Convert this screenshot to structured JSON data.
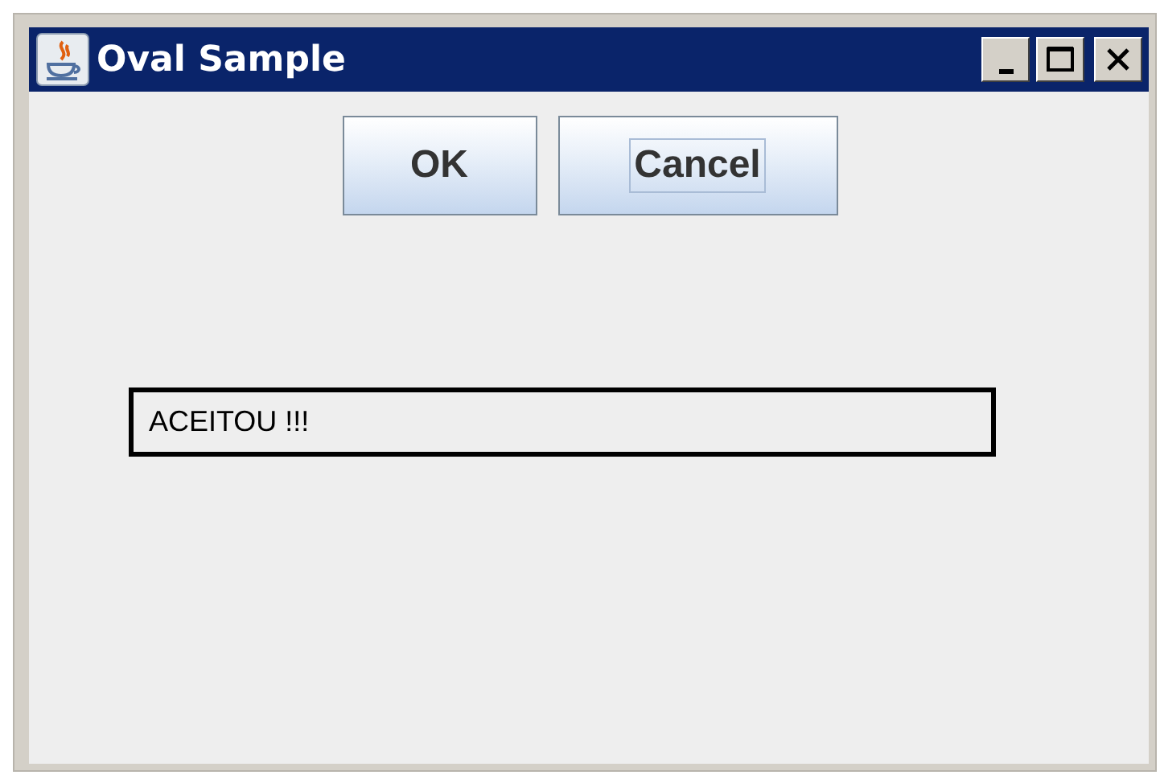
{
  "window": {
    "title": "Oval Sample"
  },
  "buttons": [
    {
      "label": "OK",
      "focused": false
    },
    {
      "label": "Cancel",
      "focused": true
    }
  ],
  "message": "ACEITOU !!!"
}
